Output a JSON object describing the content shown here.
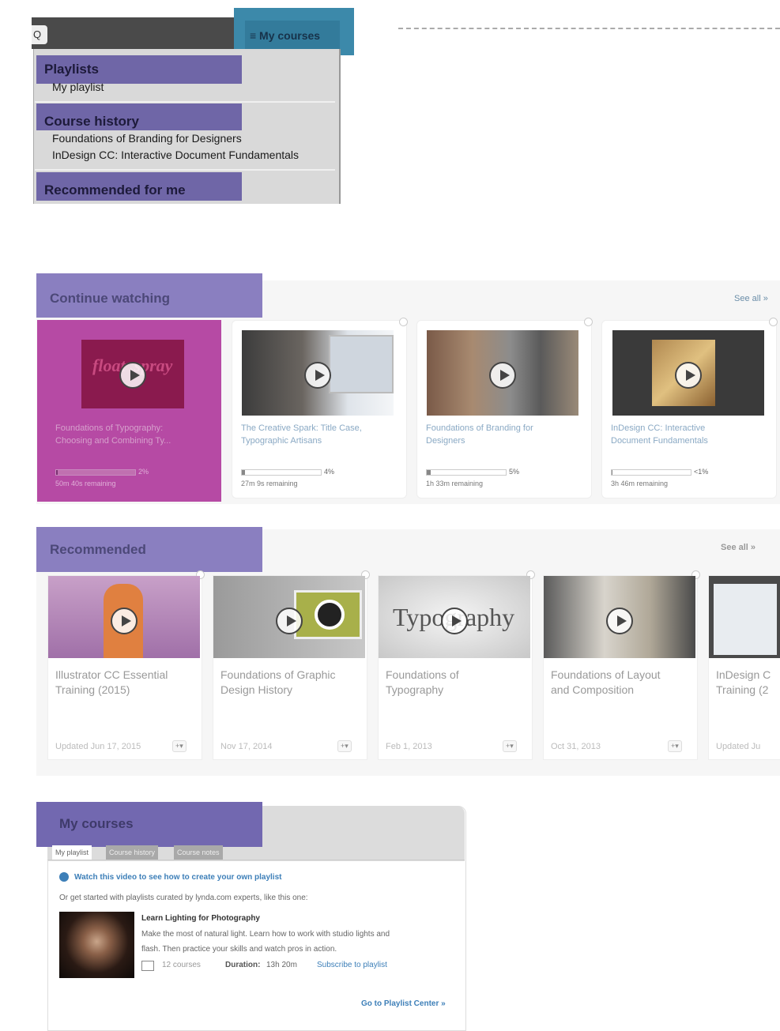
{
  "dropdown": {
    "search_icon": "search-icon",
    "search_glyph": "Q",
    "my_courses_label": "≡ My courses",
    "sections": [
      {
        "title": "Playlists",
        "items": [
          "My playlist"
        ]
      },
      {
        "title": "Course history",
        "items": [
          "Foundations of Branding for Designers",
          "InDesign CC: Interactive Document Fundamentals"
        ]
      },
      {
        "title": "Recommended for me",
        "items": []
      }
    ]
  },
  "continue_watching": {
    "title": "Continue watching",
    "see_all": "See all »",
    "cards": [
      {
        "title_line1": "Foundations of Typography:",
        "title_line2": "Choosing and Combining Ty...",
        "progress": 0.02,
        "pct": "2%",
        "remaining": "50m 40s remaining",
        "thumb_text": "float .spray"
      },
      {
        "title_line1": "The Creative Spark: Title Case,",
        "title_line2": "Typographic Artisans",
        "progress": 0.04,
        "pct": "4%",
        "remaining": "27m 9s remaining"
      },
      {
        "title_line1": "Foundations of Branding for",
        "title_line2": "Designers",
        "progress": 0.05,
        "pct": "5%",
        "remaining": "1h 33m remaining"
      },
      {
        "title_line1": "InDesign CC: Interactive",
        "title_line2": "Document Fundamentals",
        "progress": 0.01,
        "pct": "<1%",
        "remaining": "3h 46m remaining"
      }
    ]
  },
  "recommended": {
    "title": "Recommended",
    "see_all": "See all »",
    "cards": [
      {
        "title_line1": "Illustrator CC Essential",
        "title_line2": "Training (2015)",
        "date": "Updated Jun 17, 2015",
        "add": "+▾"
      },
      {
        "title_line1": "Foundations of Graphic",
        "title_line2": "Design History",
        "date": "Nov 17, 2014",
        "add": "+▾"
      },
      {
        "title_line1": "Foundations of",
        "title_line2": "Typography",
        "date": "Feb 1, 2013",
        "add": "+▾",
        "thumb_text": "Typography"
      },
      {
        "title_line1": "Foundations of Layout",
        "title_line2": "and Composition",
        "date": "Oct 31, 2013",
        "add": "+▾"
      },
      {
        "title_line1": "InDesign C",
        "title_line2": "Training (2",
        "date": "Updated Ju"
      }
    ]
  },
  "my_courses": {
    "title": "My courses",
    "tabs": [
      "My playlist",
      "Course history",
      "Course notes"
    ],
    "watch_link": "Watch this video to see how to create your own playlist",
    "intro": "Or get started with playlists curated by lynda.com experts, like this one:",
    "playlist_title": "Learn Lighting for Photography",
    "playlist_desc_1": "Make the most of natural light. Learn how to work with studio lights and",
    "playlist_desc_2": "flash. Then practice your skills and watch pros in action.",
    "courses_count": "12 courses",
    "duration_label": "Duration:",
    "duration_value": "13h 20m",
    "subscribe": "Subscribe to playlist",
    "go_to_center": "Go to Playlist Center »"
  }
}
